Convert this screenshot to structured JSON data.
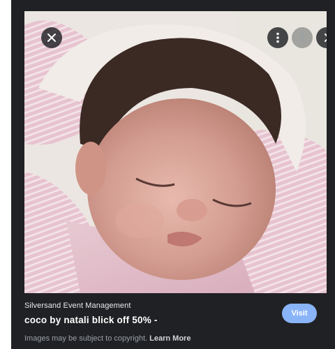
{
  "viewer": {
    "image_alt": "Sleeping baby wrapped in pink striped blanket",
    "buttons": {
      "close": "close-icon",
      "more": "more-vert-icon",
      "prev": "chevron-left-icon",
      "next": "chevron-right-icon"
    }
  },
  "result": {
    "source": "Silversand Event Management",
    "title": "coco by natali blick off 50% -",
    "visit_label": "Visit",
    "copyright_text": "Images may be subject to copyright.",
    "learn_more_label": "Learn More"
  },
  "colors": {
    "panel_bg": "#202124",
    "visit_button": "#8ab4f8",
    "muted_text": "#9aa0a6"
  }
}
